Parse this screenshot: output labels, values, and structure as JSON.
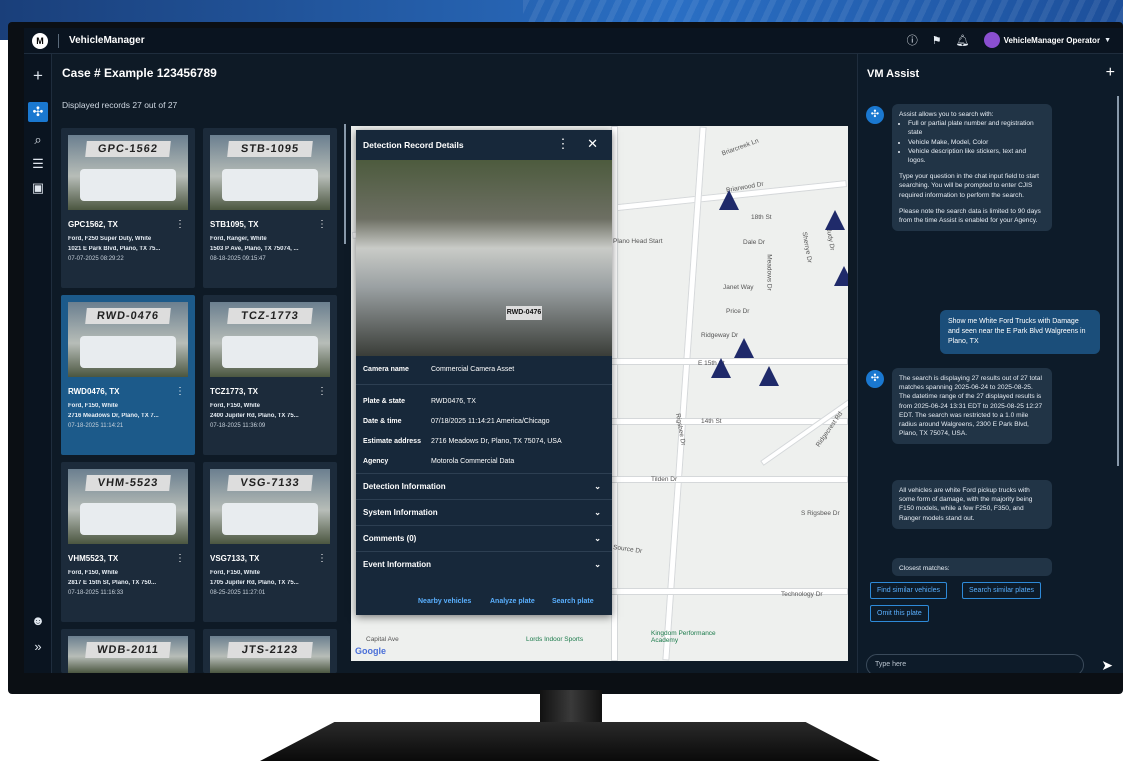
{
  "app": {
    "title": "VehicleManager",
    "user": "VehicleManager Operator"
  },
  "topbar_icons": [
    "info-icon",
    "flag-notification-icon",
    "bell-icon",
    "avatar",
    "caret-down-icon"
  ],
  "rail": {
    "items": [
      "plus-icon",
      "assist-icon",
      "search-icon",
      "list-icon",
      "archive-icon",
      "smiley-icon",
      "expand-icon"
    ]
  },
  "case": {
    "title": "Case # Example 123456789",
    "displayed": "Displayed records 27 out of 27"
  },
  "records": [
    {
      "plate_img": "GPC-1562",
      "plate": "GPC1562, TX",
      "desc": "Ford, F250 Super Duty, White",
      "address": "1021 E Park Blvd, Plano, TX 75...",
      "datetime": "07-07-2025 08:29:22"
    },
    {
      "plate_img": "STB-1095",
      "plate": "STB1095, TX",
      "desc": "Ford, Ranger, White",
      "address": "1503 P Ave, Plano, TX 75074, ...",
      "datetime": "08-18-2025 09:15:47"
    },
    {
      "plate_img": "RWD-0476",
      "plate": "RWD0476, TX",
      "desc": "Ford, F150, White",
      "address": "2716 Meadows Dr, Plano, TX 7...",
      "datetime": "07-18-2025 11:14:21"
    },
    {
      "plate_img": "TCZ-1773",
      "plate": "TCZ1773, TX",
      "desc": "Ford, F150, White",
      "address": "2400 Jupiter Rd, Plano, TX 75...",
      "datetime": "07-18-2025 11:36:09"
    },
    {
      "plate_img": "VHM-5523",
      "plate": "VHM5523, TX",
      "desc": "Ford, F150, White",
      "address": "2817 E 15th St, Plano, TX 750...",
      "datetime": "07-18-2025 11:16:33"
    },
    {
      "plate_img": "VSG-7133",
      "plate": "VSG7133, TX",
      "desc": "Ford, F150, White",
      "address": "1705 Jupiter Rd, Plano, TX 75...",
      "datetime": "08-25-2025 11:27:01"
    },
    {
      "plate_img": "WDB-2011",
      "plate": "",
      "desc": "",
      "address": "",
      "datetime": ""
    },
    {
      "plate_img": "JTS-2123",
      "plate": "",
      "desc": "",
      "address": "",
      "datetime": ""
    }
  ],
  "detail": {
    "title": "Detection Record Details",
    "camera_name_label": "Camera name",
    "camera_name": "Commercial Camera Asset",
    "photo_plate": "RWD-0476",
    "fields": [
      {
        "k": "Plate & state",
        "v": "RWD0476, TX"
      },
      {
        "k": "Date & time",
        "v": "07/18/2025  11:14:21 America/Chicago"
      },
      {
        "k": "Estimate address",
        "v": "2716 Meadows Dr, Plano, TX 75074, USA"
      },
      {
        "k": "Agency",
        "v": "Motorola Commercial Data"
      }
    ],
    "sections": [
      "Detection Information",
      "System Information",
      "Comments (0)",
      "Event Information"
    ],
    "actions": [
      "Nearby vehicles",
      "Analyze plate",
      "Search plate"
    ]
  },
  "map": {
    "labels": [
      "Briarcreek Ln",
      "Briarwood Dr",
      "18th St",
      "Plano Head Start",
      "Dale Dr",
      "Meadows Dr",
      "Sherrye Dr",
      "Judy Dr",
      "Janet Way",
      "Price Dr",
      "Ridgeway Dr",
      "E 15th St",
      "14th St",
      "Rigsbee Dr",
      "Tilden Dr",
      "S Rigsbee Dr",
      "Technology Dr",
      "Capital Ave",
      "Lords Indoor Sports",
      "Kingdom Performance Academy",
      "Source Dr",
      "Ridgecrest Rd"
    ],
    "brand": "Google"
  },
  "assist": {
    "title": "VM Assist",
    "intro": "Assist allows you to search with:",
    "bullets": [
      "Full or partial plate number and registration state",
      "Vehicle Make, Model, Color",
      "Vehicle description like stickers, text and logos."
    ],
    "p2": "Type your question in the chat input field to start searching. You will be prompted to enter CJIS required information to perform the search.",
    "p3": "Please note the search data is limited to 90 days from the time Assist is enabled for your Agency.",
    "user_msg": "Show me White Ford Trucks with Damage and seen near the E Park Blvd Walgreens in Plano, TX",
    "reply1": "The search is displaying 27 results out of 27 total matches spanning 2025-06-24 to 2025-08-25. The datetime range of the 27 displayed results is from 2025-06-24 13:31 EDT to 2025-08-25 12:27 EDT. The search was restricted to a 1.0 mile radius around Walgreens, 2300 E Park Blvd, Plano, TX 75074, USA.",
    "reply2": "All vehicles are white Ford pickup trucks with some form of damage, with the majority being F150 models, while a few F250, F350, and Ranger models stand out.",
    "reply3": "Closest matches:",
    "buttons": [
      "Find similar vehicles",
      "Search similar plates",
      "Omit this plate"
    ],
    "input_placeholder": "Type here"
  },
  "colors": {
    "accent": "#1a78d0",
    "selected_card": "#1c5a8a",
    "panel": "#0e1a26",
    "link": "#5ab0ff"
  }
}
